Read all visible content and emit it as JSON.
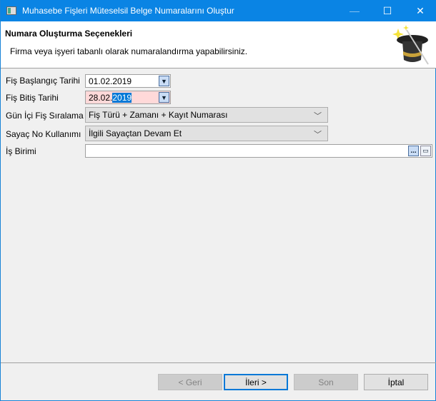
{
  "window": {
    "title": "Muhasebe Fişleri Müteselsil Belge Numaralarını Oluştur"
  },
  "header": {
    "title": "Numara Oluşturma Seçenekleri",
    "subtitle": "Firma veya işyeri tabanlı olarak numaralandırma yapabilirsiniz.",
    "icon": "magic-hat-wand"
  },
  "form": {
    "start_date": {
      "label": "Fiş Başlangıç Tarihi",
      "value": "01.02.2019"
    },
    "end_date": {
      "label": "Fiş Bitiş Tarihi",
      "value_prefix": "28.02.",
      "value_selected": "2019",
      "highlight": "#ffd9d9"
    },
    "ordering": {
      "label": "Gün İçi Fiş Sıralama",
      "value": "Fiş Türü + Zamanı + Kayıt Numarası"
    },
    "counter": {
      "label": "Sayaç No Kullanımı",
      "value": "İlgili Sayaçtan Devam Et"
    },
    "unit": {
      "label": "İş Birimi",
      "value": "",
      "browse": "..."
    }
  },
  "buttons": {
    "back": "< Geri",
    "next": "İleri >",
    "finish": "Son",
    "cancel": "İptal"
  },
  "colors": {
    "titlebar": "#0a84e4",
    "accent": "#0078d7"
  }
}
